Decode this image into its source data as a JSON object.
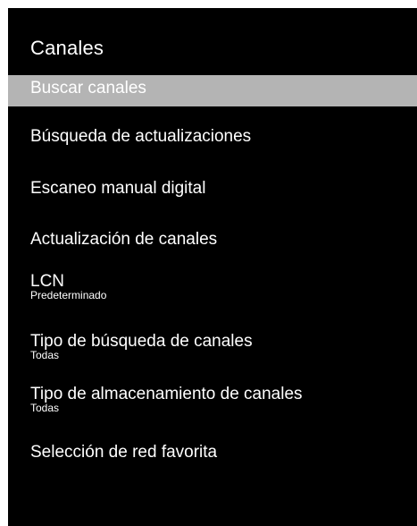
{
  "menu": {
    "title": "Canales",
    "items": [
      {
        "label": "Buscar canales"
      },
      {
        "label": "Búsqueda de actualizaciones"
      },
      {
        "label": "Escaneo manual digital"
      },
      {
        "label": "Actualización de canales"
      },
      {
        "label": "LCN",
        "value": "Predeterminado"
      },
      {
        "label": "Tipo de búsqueda de canales",
        "value": "Todas"
      },
      {
        "label": "Tipo de almacenamiento de canales",
        "value": "Todas"
      },
      {
        "label": "Selección de red favorita"
      }
    ],
    "selected_index": 0
  },
  "colors": {
    "background": "#000000",
    "text": "#ffffff",
    "highlight": "#b4b4b4",
    "frame": "#ffffff"
  }
}
